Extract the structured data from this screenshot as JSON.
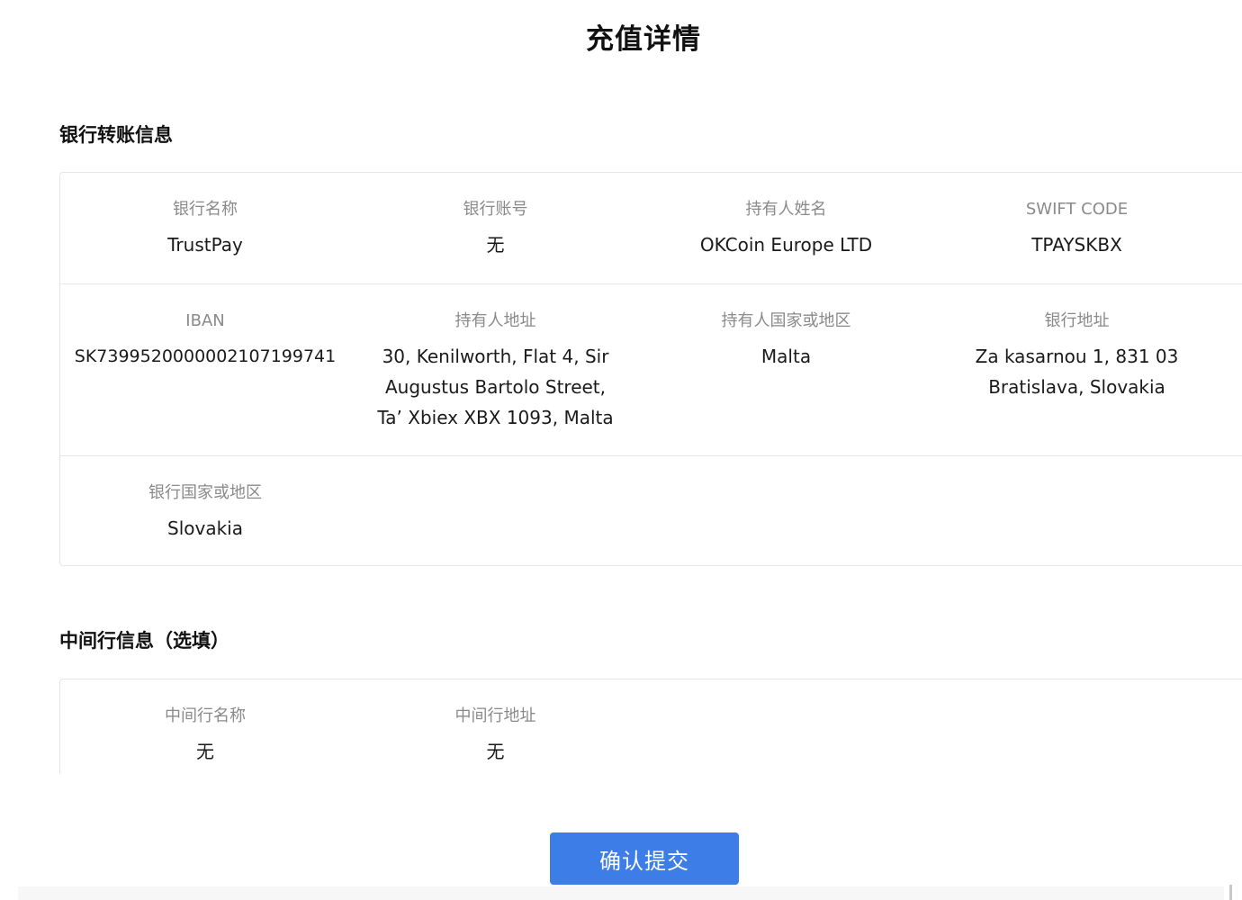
{
  "page": {
    "title": "充值详情"
  },
  "bank_section": {
    "title": "银行转账信息",
    "rows": [
      [
        {
          "label": "银行名称",
          "value": "TrustPay"
        },
        {
          "label": "银行账号",
          "value": "无"
        },
        {
          "label": "持有人姓名",
          "value": "OKCoin Europe LTD"
        },
        {
          "label": "SWIFT CODE",
          "value": "TPAYSKBX"
        }
      ],
      [
        {
          "label": "IBAN",
          "value": "SK7399520000002107199741"
        },
        {
          "label": "持有人地址",
          "value": "30, Kenilworth, Flat 4, Sir Augustus Bartolo Street, Ta’ Xbiex XBX 1093, Malta"
        },
        {
          "label": "持有人国家或地区",
          "value": "Malta"
        },
        {
          "label": "银行地址",
          "value": "Za kasarnou 1, 831 03 Bratislava, Slovakia"
        }
      ],
      [
        {
          "label": "银行国家或地区",
          "value": "Slovakia"
        }
      ]
    ]
  },
  "intermediary_section": {
    "title": "中间行信息（选填）",
    "rows": [
      [
        {
          "label": "中间行名称",
          "value": "无"
        },
        {
          "label": "中间行地址",
          "value": "无"
        }
      ]
    ]
  },
  "actions": {
    "confirm_label": "确认提交"
  },
  "colors": {
    "primary_button": "#3d7de8",
    "label_gray": "#8a8a8a",
    "border": "#e6e6e6"
  }
}
